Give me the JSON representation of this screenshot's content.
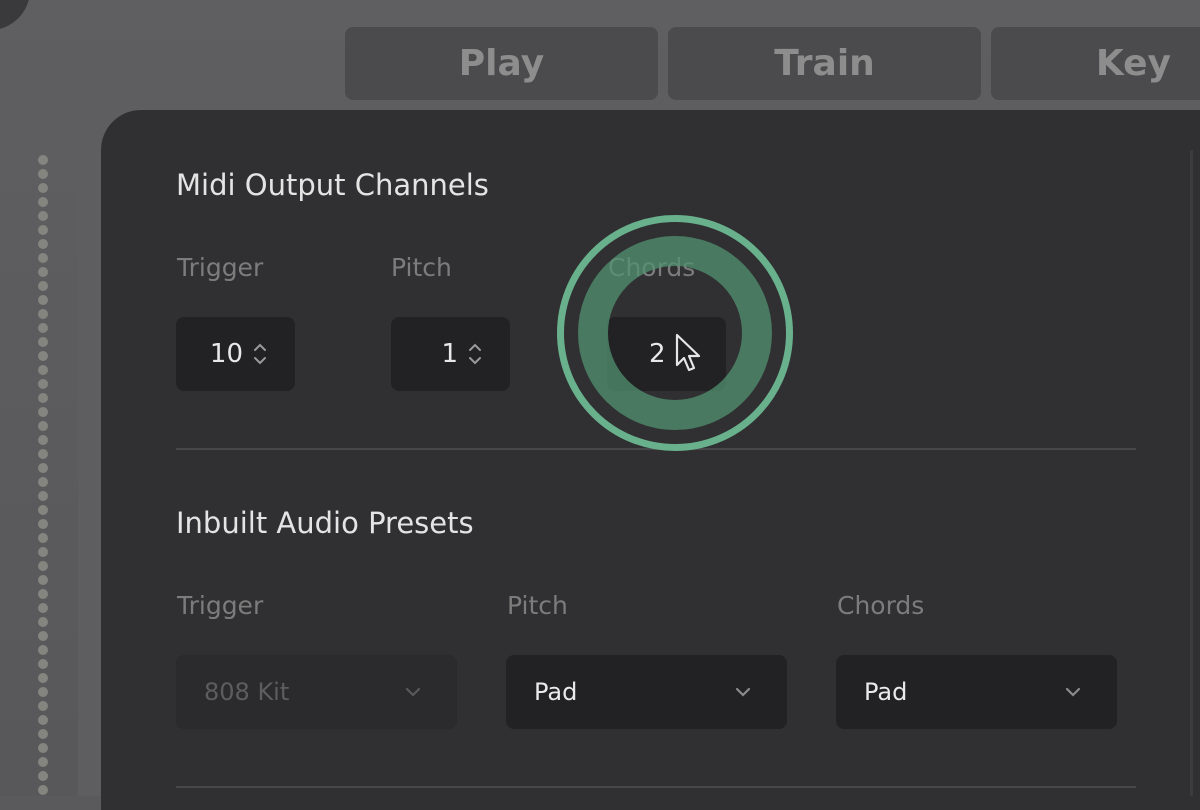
{
  "tabs": [
    {
      "label": "Play"
    },
    {
      "label": "Train"
    },
    {
      "label": "Key"
    }
  ],
  "midi_output": {
    "title": "Midi Output Channels",
    "fields": [
      {
        "label": "Trigger",
        "value": "10"
      },
      {
        "label": "Pitch",
        "value": "1"
      },
      {
        "label": "Chords",
        "value": "2"
      }
    ]
  },
  "audio_presets": {
    "title": "Inbuilt Audio Presets",
    "fields": [
      {
        "label": "Trigger",
        "value": "808 Kit",
        "disabled": true
      },
      {
        "label": "Pitch",
        "value": "Pad",
        "disabled": false
      },
      {
        "label": "Chords",
        "value": "Pad",
        "disabled": false
      }
    ]
  },
  "highlight": {
    "target": "Chords channel stepper",
    "color": "#69b08d"
  },
  "icons": {
    "stepper": "chevron-up-down-icon",
    "dropdown": "chevron-down-icon",
    "cursor": "mouse-pointer-icon"
  }
}
